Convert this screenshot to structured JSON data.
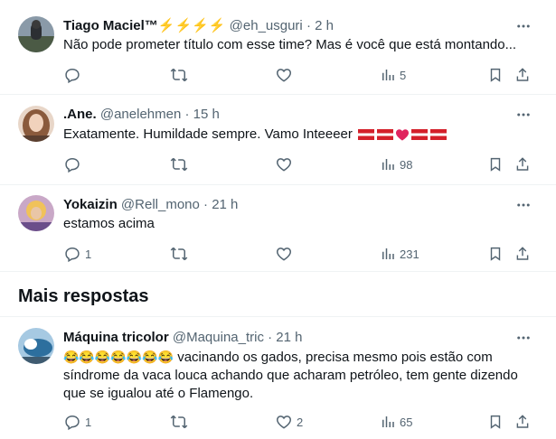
{
  "tweets": [
    {
      "name": "Tiago Maciel™",
      "name_emojis": "⚡⚡⚡⚡",
      "handle": "@eh_usguri",
      "time": "· 2 h",
      "text": "Não pode prometer título com esse time? Mas é você que está montando...",
      "reply_count": "",
      "retweet_count": "",
      "like_count": "",
      "views": "5"
    },
    {
      "name": ".Ane.",
      "handle": "@anelehmen",
      "time": "· 15 h",
      "text": "Exatamente. Humildade sempre. Vamo Inteeeer",
      "reply_count": "",
      "retweet_count": "",
      "like_count": "",
      "views": "98"
    },
    {
      "name": "Yokaizin",
      "handle": "@Rell_mono",
      "time": "· 21 h",
      "text": "estamos acima",
      "reply_count": "1",
      "retweet_count": "",
      "like_count": "",
      "views": "231"
    }
  ],
  "section_title": "Mais respostas",
  "more": [
    {
      "name": "Máquina tricolor",
      "handle": "@Maquina_tric",
      "time": "· 21 h",
      "text": "vacinando os gados, precisa mesmo pois estão com síndrome da vaca louca achando que acharam petróleo, tem gente dizendo que se igualou até o Flamengo.",
      "emojis": "😂😂😂😂😂😂😂",
      "reply_count": "1",
      "retweet_count": "",
      "like_count": "2",
      "views": "65"
    }
  ],
  "icons": [
    "reply-icon",
    "retweet-icon",
    "like-icon",
    "views-icon",
    "bookmark-icon",
    "share-icon",
    "more-icon"
  ],
  "colors": {
    "text": "#0f1419",
    "secondary": "#536471",
    "divider": "#eff3f4",
    "bolt": "#f4b400",
    "heart": "#e0245e",
    "flag_red": "#d4202a"
  }
}
